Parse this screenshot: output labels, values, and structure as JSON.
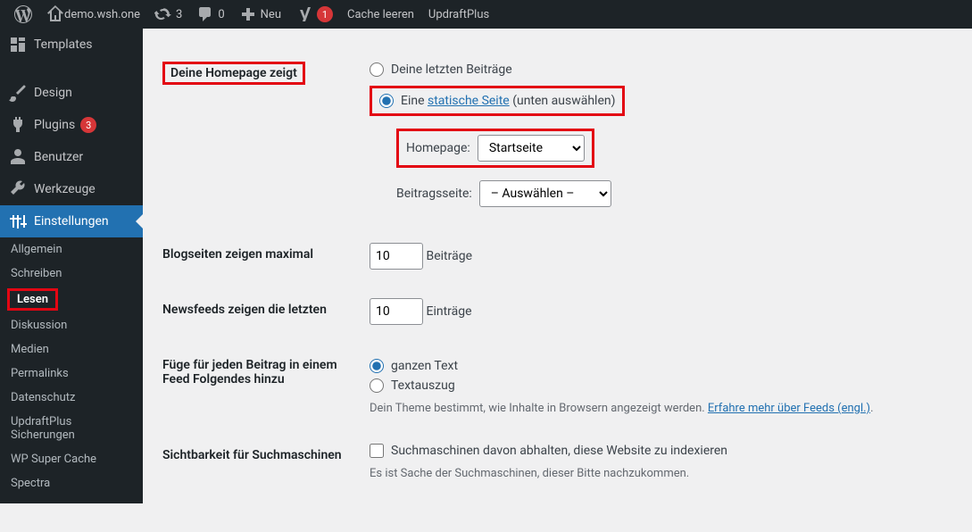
{
  "adminbar": {
    "site": "demo.wsh.one",
    "updates": "3",
    "comments": "0",
    "new": "Neu",
    "yoast_badge": "1",
    "cache": "Cache leeren",
    "updraft": "UpdraftPlus"
  },
  "sidebar": {
    "templates": "Templates",
    "design": "Design",
    "plugins": "Plugins",
    "plugins_count": "3",
    "benutzer": "Benutzer",
    "werkzeuge": "Werkzeuge",
    "einstellungen": "Einstellungen",
    "sub": {
      "allgemein": "Allgemein",
      "schreiben": "Schreiben",
      "lesen": "Lesen",
      "diskussion": "Diskussion",
      "medien": "Medien",
      "permalinks": "Permalinks",
      "datenschutz": "Datenschutz",
      "updraft": "UpdraftPlus Sicherungen",
      "wpsc": "WP Super Cache",
      "spectra": "Spectra"
    }
  },
  "form": {
    "homepage_label": "Deine Homepage zeigt",
    "opt_latest": "Deine letzten Beiträge",
    "opt_static_pre": "Eine ",
    "opt_static_link": "statische Seite",
    "opt_static_post": " (unten auswählen)",
    "hp_label": "Homepage:",
    "hp_value": "Startseite",
    "posts_label": "Beitragsseite:",
    "posts_value": "– Auswählen –",
    "blog_label": "Blogseiten zeigen maximal",
    "blog_value": "10",
    "blog_unit": "Beiträge",
    "feed_label": "Newsfeeds zeigen die letzten",
    "feed_value": "10",
    "feed_unit": "Einträge",
    "feedtype_label": "Füge für jeden Beitrag in einem Feed Folgendes hinzu",
    "feedtype_full": "ganzen Text",
    "feedtype_excerpt": "Textauszug",
    "feedtype_desc_pre": "Dein Theme bestimmt, wie Inhalte in Browsern angezeigt werden. ",
    "feedtype_desc_link": "Erfahre mehr über Feeds (engl.)",
    "feedtype_desc_post": ".",
    "seo_label": "Sichtbarkeit für Suchmaschinen",
    "seo_check": "Suchmaschinen davon abhalten, diese Website zu indexieren",
    "seo_desc": "Es ist Sache der Suchmaschinen, dieser Bitte nachzukommen."
  }
}
